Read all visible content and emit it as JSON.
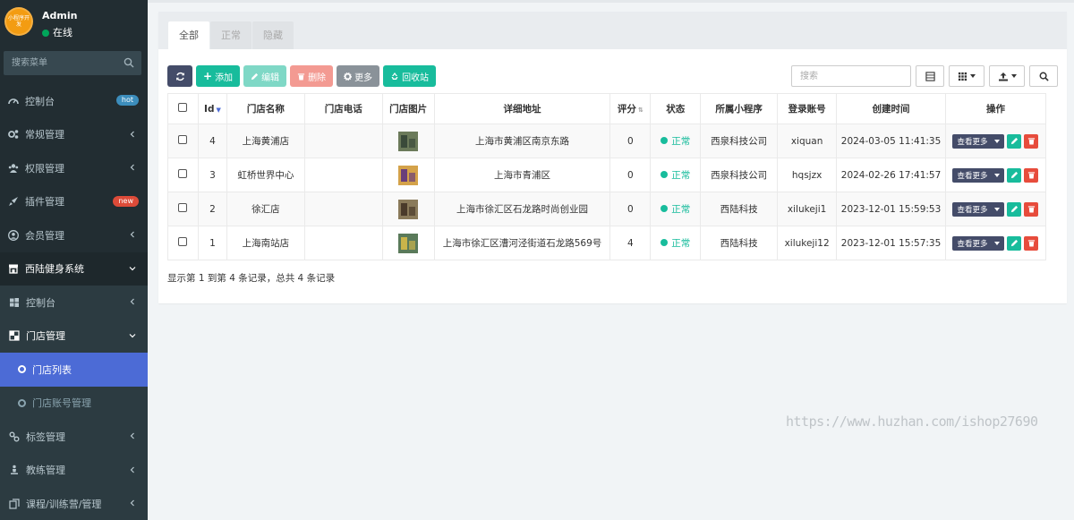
{
  "user": {
    "name": "Admin",
    "status": "在线",
    "avatar_text": "小程序开发"
  },
  "sidebar": {
    "search_placeholder": "搜索菜单",
    "items": [
      {
        "label": "控制台",
        "badge": "hot"
      },
      {
        "label": "常规管理"
      },
      {
        "label": "权限管理"
      },
      {
        "label": "插件管理",
        "badge": "new"
      },
      {
        "label": "会员管理"
      },
      {
        "label": "西陆健身系统"
      },
      {
        "label": "控制台"
      },
      {
        "label": "门店管理"
      },
      {
        "label": "门店列表"
      },
      {
        "label": "门店账号管理"
      },
      {
        "label": "标签管理"
      },
      {
        "label": "教练管理"
      },
      {
        "label": "课程/训练营/管理"
      }
    ]
  },
  "tabs": [
    "全部",
    "正常",
    "隐藏"
  ],
  "toolbar": {
    "add": "添加",
    "edit": "编辑",
    "delete": "删除",
    "more": "更多",
    "recycle": "回收站"
  },
  "search": {
    "placeholder": "搜索"
  },
  "table": {
    "headers": [
      "Id",
      "门店名称",
      "门店电话",
      "门店图片",
      "详细地址",
      "评分",
      "状态",
      "所属小程序",
      "登录账号",
      "创建时间",
      "操作"
    ],
    "rows": [
      {
        "id": "4",
        "name": "上海黄浦店",
        "phone": "",
        "address": "上海市黄浦区南京东路",
        "score": "0",
        "status": "正常",
        "app": "西泉科技公司",
        "account": "xiquan",
        "created": "2024-03-05 11:41:35"
      },
      {
        "id": "3",
        "name": "虹桥世界中心",
        "phone": "",
        "address": "上海市青浦区",
        "score": "0",
        "status": "正常",
        "app": "西泉科技公司",
        "account": "hqsjzx",
        "created": "2024-02-26 17:41:57"
      },
      {
        "id": "2",
        "name": "徐汇店",
        "phone": "",
        "address": "上海市徐汇区石龙路时尚创业园",
        "score": "0",
        "status": "正常",
        "app": "西陆科技",
        "account": "xilukeji1",
        "created": "2023-12-01 15:59:53"
      },
      {
        "id": "1",
        "name": "上海南站店",
        "phone": "",
        "address": "上海市徐汇区漕河泾街道石龙路569号",
        "score": "4",
        "status": "正常",
        "app": "西陆科技",
        "account": "xilukeji12",
        "created": "2023-12-01 15:57:35"
      }
    ],
    "row_more_label": "查看更多"
  },
  "pagination": "显示第 1 到第 4 条记录，总共 4 条记录",
  "watermark": "https://www.huzhan.com/ishop27690",
  "colors": {
    "sidebar": "#222d32",
    "active": "#4c6bd6",
    "green": "#18bc9c",
    "red": "#e74c3c",
    "dark_btn": "#444c69"
  }
}
